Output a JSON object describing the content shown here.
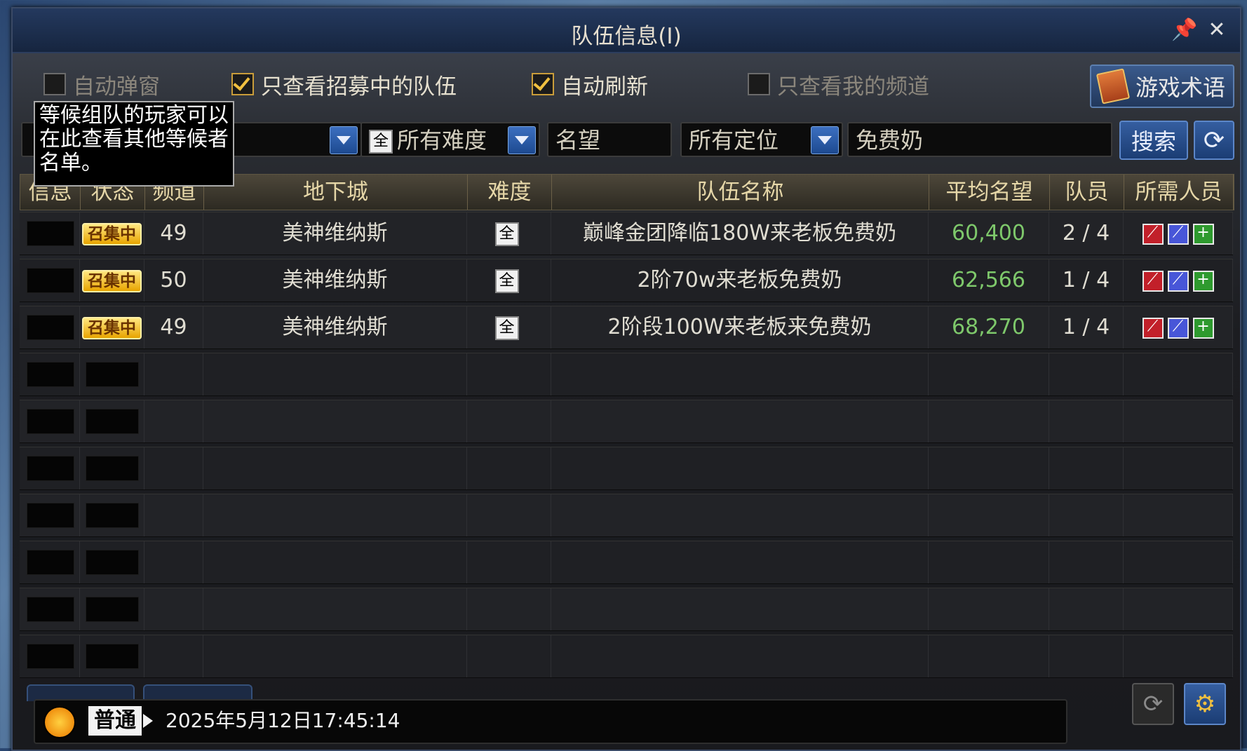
{
  "window": {
    "title": "队伍信息(I)",
    "pin_icon": "pin-icon",
    "close_icon": "close-icon"
  },
  "filters": {
    "auto_popup": {
      "label": "自动弹窗",
      "checked": false
    },
    "only_recruiting": {
      "label": "只查看招募中的队伍",
      "checked": true
    },
    "auto_refresh": {
      "label": "自动刷新",
      "checked": true
    },
    "only_my_channel": {
      "label": "只查看我的频道",
      "checked": false
    },
    "game_terms_button": "游戏术语"
  },
  "search": {
    "dungeon_select": "",
    "difficulty_select": "所有难度",
    "difficulty_icon_text": "全",
    "reputation_field": "名望",
    "role_select": "所有定位",
    "keyword_field": "免费奶",
    "search_button": "搜索"
  },
  "tooltip": {
    "text": "等候组队的玩家可以在此查看其他等候者名单。"
  },
  "table": {
    "headers": [
      "信息",
      "状态",
      "频道",
      "地下城",
      "难度",
      "队伍名称",
      "平均名望",
      "队员",
      "所需人员"
    ],
    "rows": [
      {
        "status": "召集中",
        "channel": "49",
        "dungeon": "美神维纳斯",
        "difficulty": "全",
        "team_name": "巅峰金团降临180W来老板免费奶",
        "avg_reputation": "60,400",
        "members": "2 / 4"
      },
      {
        "status": "召集中",
        "channel": "50",
        "dungeon": "美神维纳斯",
        "difficulty": "全",
        "team_name": "2阶70w来老板免费奶",
        "avg_reputation": "62,566",
        "members": "1 / 4"
      },
      {
        "status": "召集中",
        "channel": "49",
        "dungeon": "美神维纳斯",
        "difficulty": "全",
        "team_name": "2阶段100W来老板来免费奶",
        "avg_reputation": "68,270",
        "members": "1 / 4"
      }
    ],
    "empty_rows": 7
  },
  "footer": {
    "mode": "普通",
    "datetime": "2025年5月12日17:45:14"
  },
  "colors": {
    "accent_blue": "#355ea0",
    "reputation_green": "#7ec86b",
    "badge_gold": "#e8a400"
  }
}
